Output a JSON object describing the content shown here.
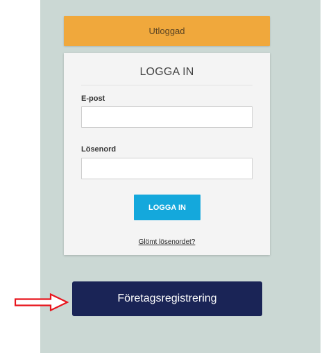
{
  "status": {
    "label": "Utloggad"
  },
  "login": {
    "title": "LOGGA IN",
    "email_label": "E-post",
    "email_value": "",
    "email_placeholder": "",
    "password_label": "Lösenord",
    "password_value": "",
    "password_placeholder": "",
    "submit_label": "LOGGA IN",
    "forgot_label": "Glömt lösenordet?"
  },
  "register": {
    "label": "Företagsregistrering"
  },
  "annotation": {
    "icon": "right-arrow-icon",
    "color": "#e8141c"
  },
  "colors": {
    "status_bar": "#f0a83c",
    "login_button": "#14a8dc",
    "register_button": "#1a2456",
    "panel_background": "#cbd8d4"
  }
}
